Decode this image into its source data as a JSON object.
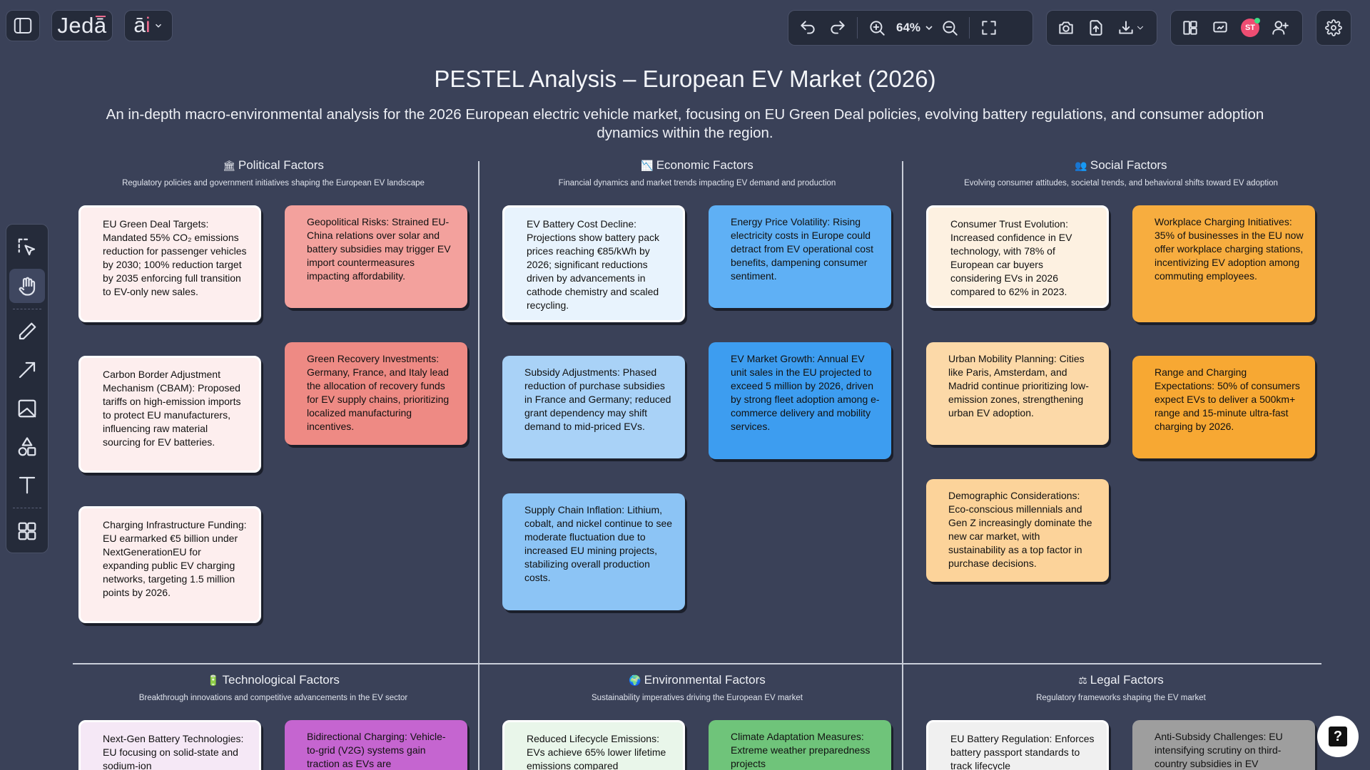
{
  "app": {
    "logo_text": "Jedā",
    "logo_main": "Jed",
    "logo_accent": "ā",
    "ai_label": "āi",
    "ai_main": "ā",
    "ai_accent": "i"
  },
  "toolbar": {
    "zoom_level": "64%",
    "avatar_initials": "ST"
  },
  "help": {
    "label": "?"
  },
  "page": {
    "title": "PESTEL Analysis – European EV Market (2026)",
    "subtitle": "An in-depth macro-environmental analysis for the 2026 European electric vehicle market, focusing on EU Green Deal policies, evolving battery regulations, and consumer adoption dynamics within the region."
  },
  "sections": {
    "political": {
      "icon": "🏛",
      "title": "Political Factors",
      "desc": "Regulatory policies and government initiatives shaping the European EV landscape"
    },
    "economic": {
      "icon": "📉",
      "title": "Economic Factors",
      "desc": "Financial dynamics and market trends impacting EV demand and production"
    },
    "social": {
      "icon": "👥",
      "title": "Social Factors",
      "desc": "Evolving consumer attitudes, societal trends, and behavioral shifts toward EV adoption"
    },
    "technological": {
      "icon": "🔋",
      "title": "Technological Factors",
      "desc": "Breakthrough innovations and competitive advancements in the EV sector"
    },
    "environmental": {
      "icon": "🌍",
      "title": "Environmental Factors",
      "desc": "Sustainability imperatives driving the European EV market"
    },
    "legal": {
      "icon": "⚖",
      "title": "Legal Factors",
      "desc": "Regulatory frameworks shaping the EV market"
    }
  },
  "cards": {
    "p1": "EU Green Deal Targets: Mandated 55% CO₂ emissions reduction for passenger vehicles by 2030; 100% reduction target by 2035 enforcing full transition to EV-only new sales.",
    "p2": "Geopolitical Risks: Strained EU-China relations over solar and battery subsidies may trigger EV import countermeasures impacting affordability.",
    "p3": "Carbon Border Adjustment Mechanism (CBAM): Proposed tariffs on high-emission imports to protect EU manufacturers, influencing raw material sourcing for EV batteries.",
    "p4": "Green Recovery Investments: Germany, France, and Italy lead the allocation of recovery funds for EV supply chains, prioritizing localized manufacturing incentives.",
    "p5": "Charging Infrastructure Funding: EU earmarked €5 billion under NextGenerationEU for expanding public EV charging networks, targeting 1.5 million points by 2026.",
    "e1": "EV Battery Cost Decline: Projections show battery pack prices reaching €85/kWh by 2026; significant reductions driven by advancements in cathode chemistry and scaled recycling.",
    "e2": "Energy Price Volatility: Rising electricity costs in Europe could detract from EV operational cost benefits, dampening consumer sentiment.",
    "e3": "Subsidy Adjustments: Phased reduction of purchase subsidies in France and Germany; reduced grant dependency may shift demand to mid-priced EVs.",
    "e4": "EV Market Growth: Annual EV unit sales in the EU projected to exceed 5 million by 2026, driven by strong fleet adoption among e-commerce delivery and mobility services.",
    "e5": "Supply Chain Inflation: Lithium, cobalt, and nickel continue to see moderate fluctuation due to increased EU mining projects, stabilizing overall production costs.",
    "s1": "Consumer Trust Evolution: Increased confidence in EV technology, with 78% of European car buyers considering EVs in 2026 compared to 62% in 2023.",
    "s2": "Workplace Charging Initiatives: 35% of businesses in the EU now offer workplace charging stations, incentivizing EV adoption among commuting employees.",
    "s3": "Urban Mobility Planning: Cities like Paris, Amsterdam, and Madrid continue prioritizing low-emission zones, strengthening urban EV adoption.",
    "s4": "Range and Charging Expectations: 50% of consumers expect EVs to deliver a 500km+ range and 15-minute ultra-fast charging by 2026.",
    "s5": "Demographic Considerations: Eco-conscious millennials and Gen Z increasingly dominate the new car market, with sustainability as a top factor in purchase decisions.",
    "t1": "Next-Gen Battery Technologies: EU focusing on solid-state and sodium-ion",
    "t2": "Bidirectional Charging: Vehicle-to-grid (V2G) systems gain traction as EVs are",
    "en1": "Reduced Lifecycle Emissions: EVs achieve 65% lower lifetime emissions compared",
    "en2": "Climate Adaptation Measures: Extreme weather preparedness projects",
    "l1": "EU Battery Regulation: Enforces battery passport standards to track lifecycle",
    "l2": "Anti-Subsidy Challenges: EU intensifying scrutiny on third-country subsidies in EV"
  },
  "colors": {
    "background": "#3a4158",
    "political_light": "#fdeeee",
    "political_mid": "#f3a19d",
    "political_dark": "#ee8a84",
    "economic_light": "#e8f3fd",
    "economic_mid": "#a9d2f7",
    "economic_dark": "#3d9df0",
    "social_light": "#fdf1e1",
    "social_mid": "#fcd39a",
    "social_dark": "#f7a833",
    "tech_light": "#f5e8f6",
    "tech_dark": "#c565d0",
    "env_light": "#e9f6ea",
    "env_dark": "#6fc47a",
    "legal_light": "#f0f0f0",
    "legal_dark": "#9e9e9e"
  }
}
